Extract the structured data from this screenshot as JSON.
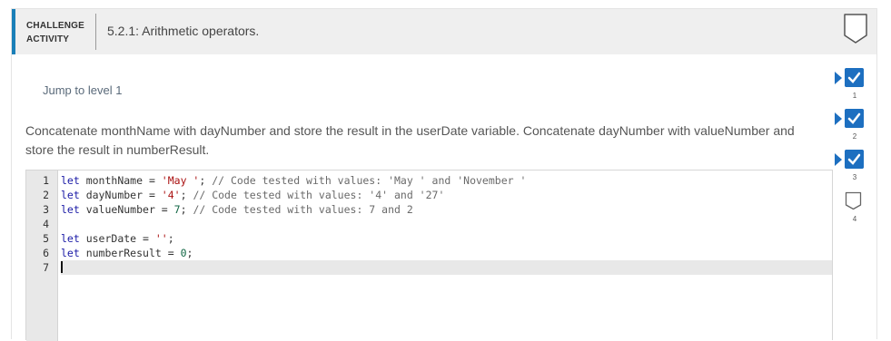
{
  "header": {
    "activity_type_line1": "CHALLENGE",
    "activity_type_line2": "ACTIVITY",
    "title": "5.2.1: Arithmetic operators."
  },
  "jump_link": "Jump to level 1",
  "instructions": "Concatenate monthName with dayNumber and store the result in the userDate variable. Concatenate dayNumber with valueNumber and store the result in numberResult.",
  "editor": {
    "lines": [
      {
        "n": "1",
        "kw": "let",
        "name": " monthName = ",
        "val": "'May '",
        "valtype": "str",
        "rest": "; ",
        "cmt": "// Code tested with values: 'May ' and 'November '"
      },
      {
        "n": "2",
        "kw": "let",
        "name": " dayNumber = ",
        "val": "'4'",
        "valtype": "str",
        "rest": "; ",
        "cmt": "// Code tested with values: '4' and '27'"
      },
      {
        "n": "3",
        "kw": "let",
        "name": " valueNumber = ",
        "val": "7",
        "valtype": "num",
        "rest": "; ",
        "cmt": "// Code tested with values: 7 and 2"
      },
      {
        "n": "4",
        "kw": "",
        "name": "",
        "val": "",
        "valtype": "",
        "rest": "",
        "cmt": ""
      },
      {
        "n": "5",
        "kw": "let",
        "name": " userDate = ",
        "val": "''",
        "valtype": "str",
        "rest": ";",
        "cmt": ""
      },
      {
        "n": "6",
        "kw": "let",
        "name": " numberResult = ",
        "val": "0",
        "valtype": "num",
        "rest": ";",
        "cmt": ""
      },
      {
        "n": "7",
        "kw": "",
        "name": "",
        "val": "",
        "valtype": "",
        "rest": "",
        "cmt": ""
      }
    ],
    "active_line": 7
  },
  "levels": [
    {
      "label": "1",
      "status": "completed",
      "icon": "check-icon"
    },
    {
      "label": "2",
      "status": "completed",
      "icon": "check-icon"
    },
    {
      "label": "3",
      "status": "completed",
      "icon": "check-icon"
    },
    {
      "label": "4",
      "status": "incomplete",
      "icon": "open-box-icon"
    }
  ],
  "colors": {
    "accent": "#1a7fb8",
    "level_blue": "#1d6fc0",
    "header_bg": "#efefef"
  }
}
